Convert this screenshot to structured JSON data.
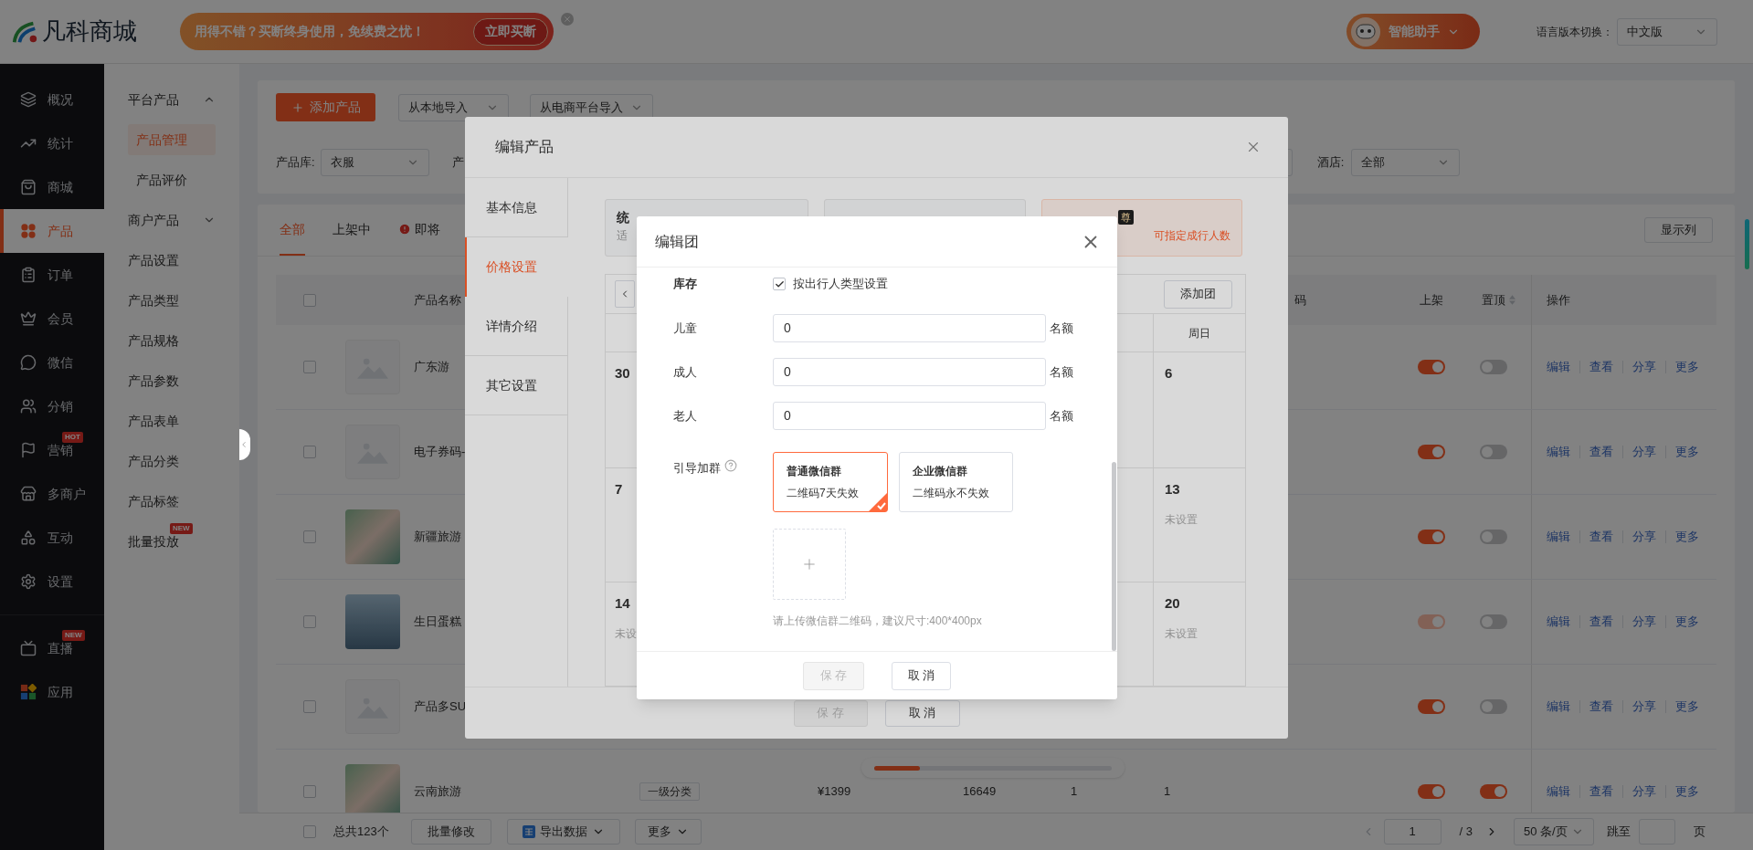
{
  "header": {
    "logo": "凡科商城",
    "promo_text": "用得不错？买断终身使用，免续费之忧！",
    "promo_button": "立即买断",
    "assistant": "智能助手",
    "language_label": "语言版本切换：",
    "language_value": "中文版"
  },
  "nav_groups": [
    {
      "items": [
        {
          "label": "概况",
          "selected": false
        },
        {
          "label": "统计",
          "selected": false
        },
        {
          "label": "商城",
          "selected": false
        },
        {
          "label": "产品",
          "selected": true
        },
        {
          "label": "订单",
          "selected": false
        },
        {
          "label": "会员",
          "selected": false
        },
        {
          "label": "微信",
          "selected": false
        },
        {
          "label": "分销",
          "selected": false
        },
        {
          "label": "营销",
          "selected": false,
          "badge": "HOT"
        },
        {
          "label": "多商户",
          "selected": false
        },
        {
          "label": "互动",
          "selected": false
        },
        {
          "label": "设置",
          "selected": false
        }
      ]
    },
    {
      "items": [
        {
          "label": "直播",
          "selected": false,
          "badge": "NEW"
        },
        {
          "label": "应用",
          "selected": false
        }
      ]
    }
  ],
  "subnav": [
    {
      "kind": "group",
      "label": "平台产品",
      "expanded": true,
      "children": [
        {
          "label": "产品管理",
          "selected": true
        },
        {
          "label": "产品评价",
          "selected": false
        }
      ]
    },
    {
      "kind": "group",
      "label": "商户产品",
      "expanded": false
    },
    {
      "kind": "item",
      "label": "产品设置",
      "selected": false
    },
    {
      "kind": "item",
      "label": "产品类型",
      "selected": false
    },
    {
      "kind": "item",
      "label": "产品规格",
      "selected": false
    },
    {
      "kind": "item",
      "label": "产品参数",
      "selected": false
    },
    {
      "kind": "item",
      "label": "产品表单",
      "selected": false
    },
    {
      "kind": "item",
      "label": "产品分类",
      "selected": false
    },
    {
      "kind": "item",
      "label": "产品标签",
      "selected": false
    },
    {
      "kind": "item",
      "label": "批量投放",
      "selected": false,
      "badge": "NEW"
    }
  ],
  "toolbar": {
    "add_button": "添加产品",
    "imports": [
      "从本地导入",
      "从电商平台导入"
    ]
  },
  "filters": {
    "left": [
      {
        "label": "产品库:",
        "value": "衣服"
      }
    ],
    "cut_label": "产",
    "right": [
      {
        "label": "酒店:",
        "value": "全部"
      }
    ]
  },
  "tabs": [
    {
      "label": "全部",
      "selected": true,
      "alert": false
    },
    {
      "label": "上架中",
      "selected": false,
      "alert": false
    },
    {
      "label": "即将",
      "selected": false,
      "alert": true
    }
  ],
  "columns_button": "显示列",
  "table": {
    "all_checked": false,
    "columns": {
      "name": "产品名称",
      "column_8": "码",
      "on_sale": "上架",
      "pinned": "置顶",
      "actions": "操作"
    },
    "rows": [
      {
        "name": "广东游",
        "kind": "placeholder",
        "checked": false,
        "on_sale": true,
        "on_sale_disabled": false,
        "pinned": false,
        "actions": [
          "编辑",
          "查看",
          "分享",
          "更多"
        ]
      },
      {
        "name": "电子券码-",
        "kind": "placeholder",
        "checked": false,
        "on_sale": true,
        "on_sale_disabled": false,
        "pinned": false,
        "actions": [
          "编辑",
          "查看",
          "分享",
          "更多"
        ]
      },
      {
        "name": "新疆旅游",
        "kind": "photo",
        "checked": false,
        "on_sale": true,
        "on_sale_disabled": false,
        "pinned": false,
        "actions": [
          "编辑",
          "查看",
          "分享",
          "更多"
        ]
      },
      {
        "name": "生日蛋糕",
        "kind": "photo",
        "checked": false,
        "on_sale": true,
        "on_sale_disabled": true,
        "pinned": false,
        "actions": [
          "编辑",
          "查看",
          "分享",
          "更多"
        ]
      },
      {
        "name": "产品多SU",
        "kind": "placeholder",
        "checked": false,
        "on_sale": true,
        "on_sale_disabled": false,
        "pinned": false,
        "actions": [
          "编辑",
          "查看",
          "分享",
          "更多"
        ]
      },
      {
        "name": "云南旅游",
        "kind": "photo",
        "checked": false,
        "category": "一级分类",
        "price": "¥1399",
        "cells": [
          "16649",
          "1",
          "1"
        ],
        "on_sale": true,
        "on_sale_disabled": false,
        "pinned": true,
        "actions": [
          "编辑",
          "查看",
          "分享",
          "更多"
        ]
      }
    ]
  },
  "footer": {
    "checked": false,
    "total": "总共123个",
    "batch_button": "批量修改",
    "export": "导出数据",
    "more": "更多",
    "page": "1",
    "pages": "/ 3",
    "page_size": "50 条/页",
    "jump_label": "跳至",
    "page_unit": "页"
  },
  "product_modal": {
    "title": "编辑产品",
    "tabs": [
      {
        "label": "基本信息",
        "selected": false
      },
      {
        "label": "价格设置",
        "selected": true
      },
      {
        "label": "详情介绍",
        "selected": false
      },
      {
        "label": "其它设置",
        "selected": false
      }
    ],
    "pricing_cards": [
      {
        "title": "统",
        "subtitle": "适",
        "highlighted": false
      },
      {
        "highlighted": false
      },
      {
        "badge": "尊",
        "subtitle": "可指定成行人数",
        "highlighted": true
      }
    ],
    "calendar": {
      "add_button": "添加团",
      "weekday": "周日",
      "left_cells": [
        {
          "day": "30"
        },
        {
          "day": "7"
        },
        {
          "day": "14",
          "note": "未设"
        }
      ],
      "right_cells": [
        {
          "day": "6"
        },
        {
          "day": "13",
          "note": "未设置"
        },
        {
          "day": "20",
          "note": "未设置"
        }
      ]
    },
    "save": "保 存",
    "save_disabled": true,
    "cancel": "取 消"
  },
  "team_modal": {
    "title": "编辑团",
    "stock_label": "库存",
    "by_type": {
      "label": "按出行人类型设置",
      "checked": true
    },
    "quotas": [
      {
        "label": "儿童",
        "value": "0",
        "unit": "名额"
      },
      {
        "label": "成人",
        "value": "0",
        "unit": "名额"
      },
      {
        "label": "老人",
        "value": "0",
        "unit": "名额"
      }
    ],
    "group_label": "引导加群",
    "group_types": [
      {
        "title": "普通微信群",
        "desc": "二维码7天失效",
        "selected": true
      },
      {
        "title": "企业微信群",
        "desc": "二维码永不失效",
        "selected": false
      }
    ],
    "upload_hint": "请上传微信群二维码，建议尺寸:400*400px",
    "save": "保 存",
    "save_disabled": true,
    "cancel": "取 消"
  }
}
